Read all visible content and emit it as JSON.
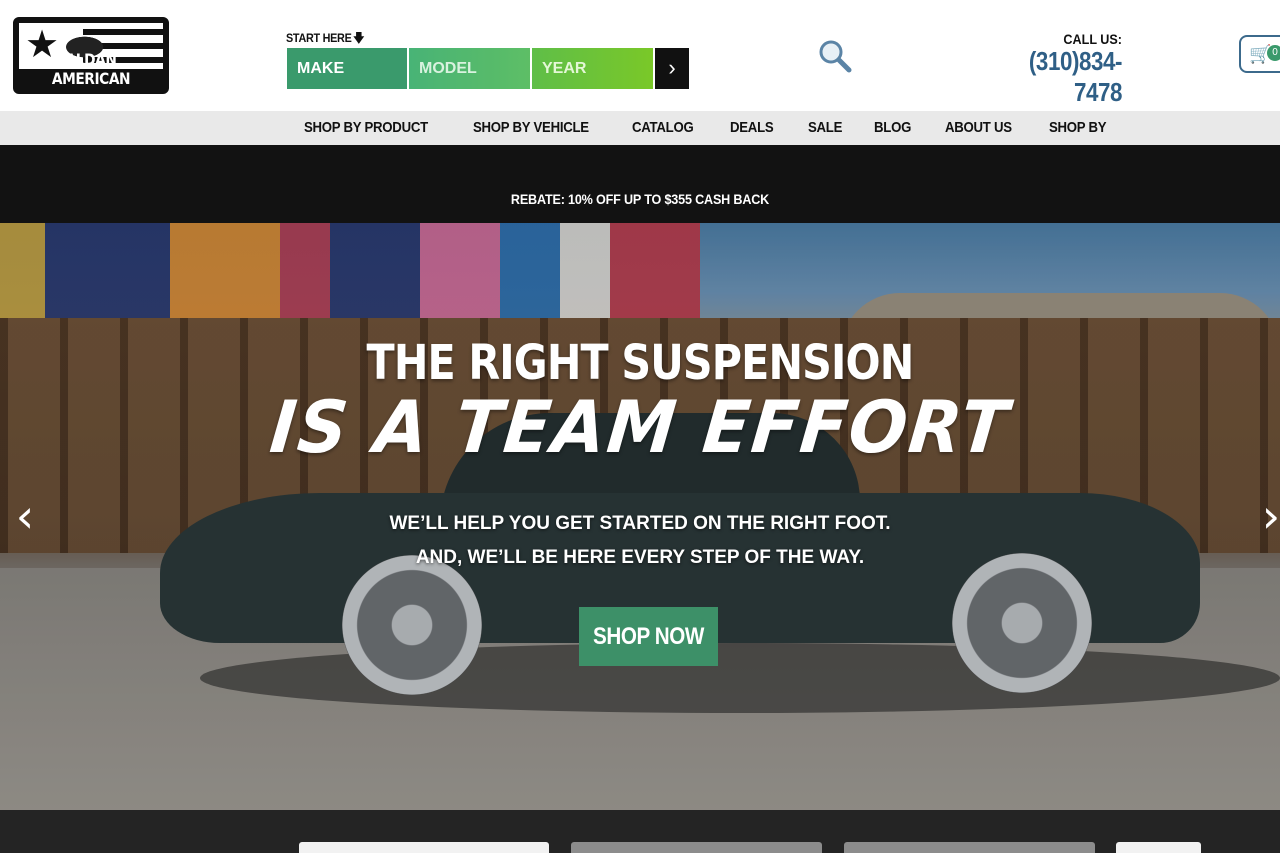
{
  "header": {
    "logo_text": "ALDAN AMERICAN",
    "start_here": "START HERE",
    "ymm": {
      "make": "MAKE",
      "model": "MODEL",
      "year": "YEAR",
      "go_icon": "chevron-right-icon"
    },
    "search_icon": "search-icon",
    "call_label": "CALL US:",
    "phone": "(310)834-7478",
    "cart_count": "0"
  },
  "nav": {
    "items": [
      {
        "label": "SHOP BY PRODUCT"
      },
      {
        "label": "SHOP BY VEHICLE"
      },
      {
        "label": "CATALOG"
      },
      {
        "label": "DEALS"
      },
      {
        "label": "SALE"
      },
      {
        "label": "BLOG"
      },
      {
        "label": "ABOUT US"
      },
      {
        "label": "SHOP BY"
      }
    ]
  },
  "promo": {
    "text": "REBATE: 10% OFF UP TO $355 CASH BACK"
  },
  "hero": {
    "headline": "THE RIGHT SUSPENSION",
    "headline2": "IS A TEAM EFFORT",
    "sub1": "WE’LL HELP YOU GET STARTED ON THE RIGHT FOOT.",
    "sub2": "AND, WE’LL BE HERE EVERY STEP OF THE WAY.",
    "cta": "SHOP NOW",
    "prev": "‹",
    "next": "›"
  },
  "colors": {
    "accent_green": "#3d9068",
    "phone_blue": "#2f5f86",
    "promo_bg": "#121212",
    "nav_bg": "#e9e9e9"
  }
}
